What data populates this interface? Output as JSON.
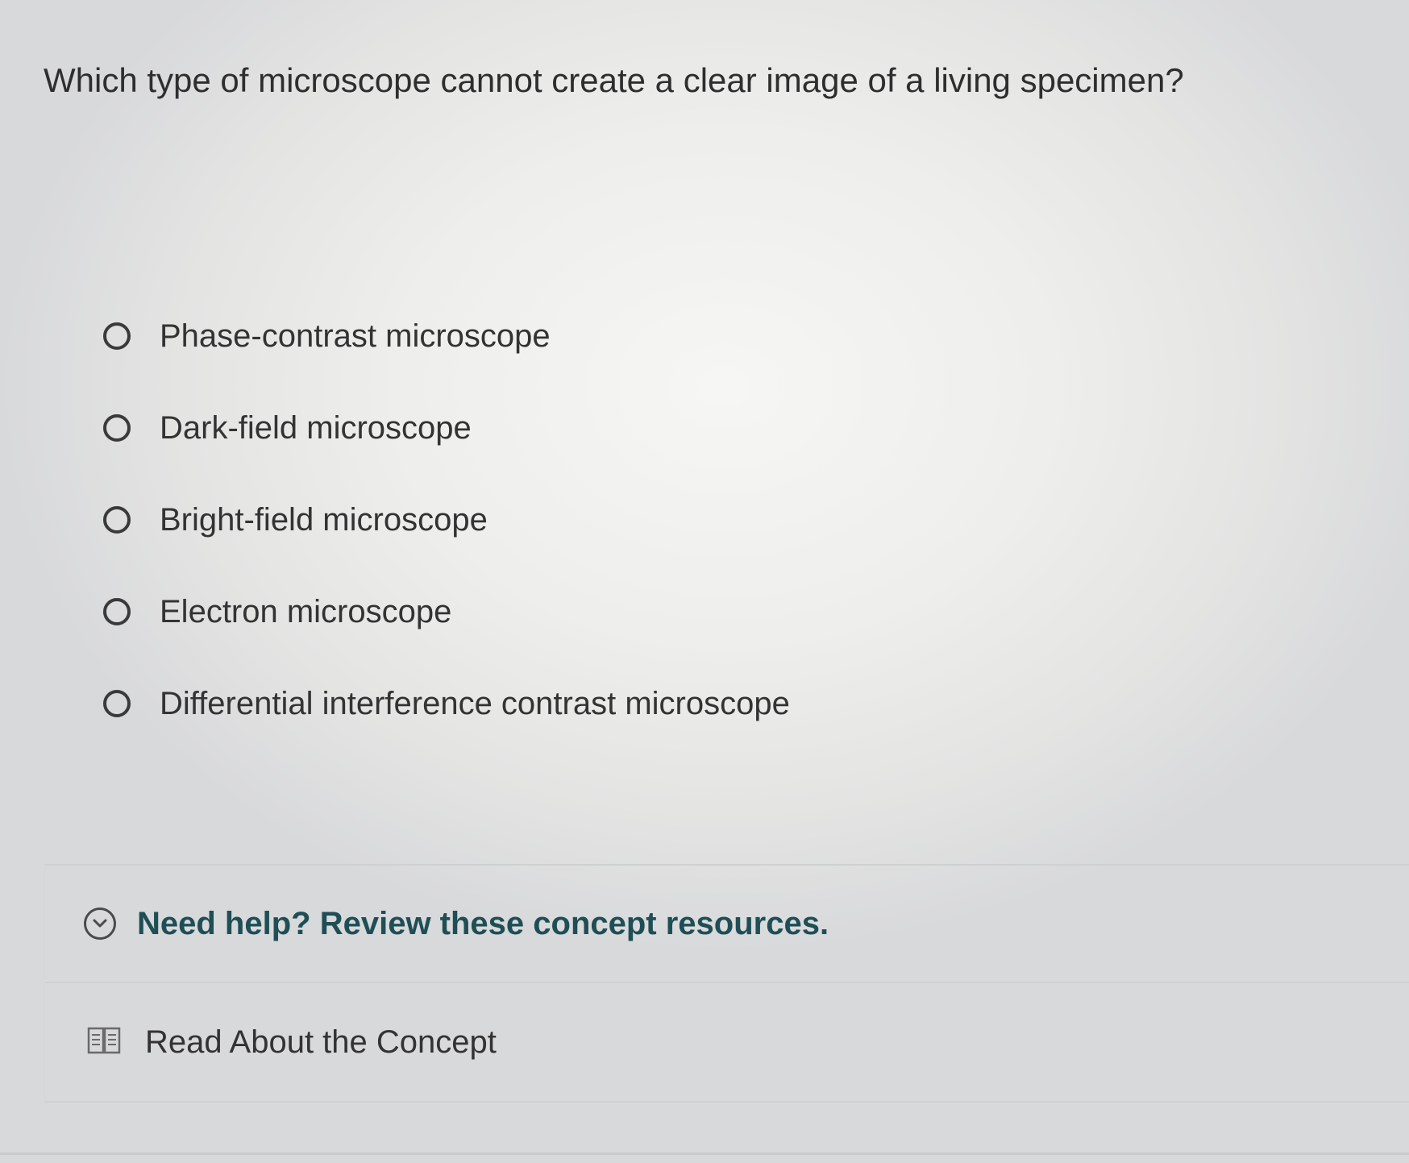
{
  "question": {
    "text": "Which type of microscope cannot create a clear image of a living specimen?"
  },
  "options": [
    {
      "label": "Phase-contrast microscope"
    },
    {
      "label": "Dark-field microscope"
    },
    {
      "label": "Bright-field microscope"
    },
    {
      "label": "Electron microscope"
    },
    {
      "label": "Differential interference contrast microscope"
    }
  ],
  "help": {
    "title": "Need help? Review these concept resources.",
    "toggle_icon": "chevron-down-circle-icon",
    "resources": [
      {
        "label": "Read About the Concept",
        "icon": "book-icon"
      }
    ]
  },
  "colors": {
    "help_title": "#1f4e55",
    "text": "#333333",
    "radio_border": "#3a3a3a"
  }
}
